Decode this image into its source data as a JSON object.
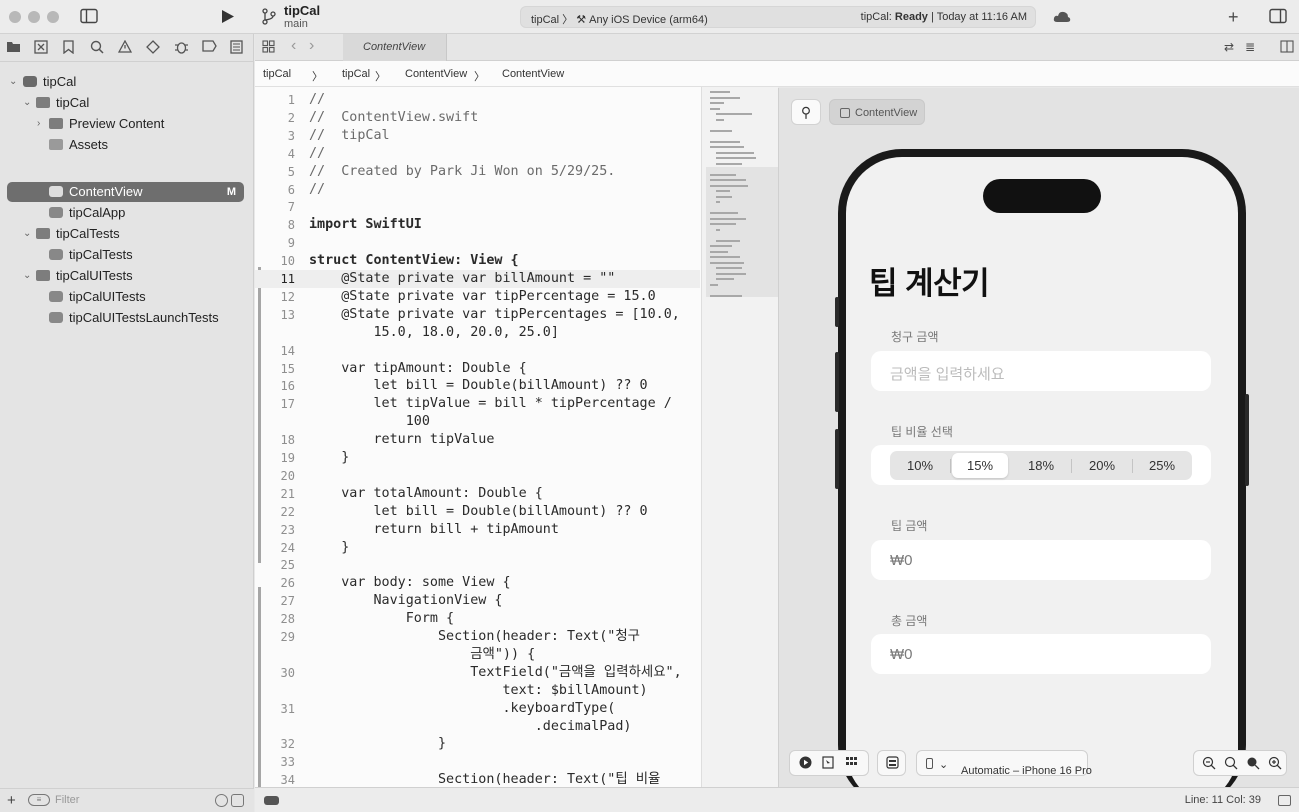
{
  "titlebar": {
    "project": "tipCal",
    "branch": "main",
    "scheme": "tipCal  〉  ⚒ Any iOS Device (arm64)",
    "status_prefix": "tipCal:",
    "status_state": "Ready",
    "status_suffix": "| Today at 11:16 AM"
  },
  "navigator": {
    "rows": [
      {
        "label": "tipCal"
      },
      {
        "label": "tipCal"
      },
      {
        "label": "Preview Content"
      },
      {
        "label": "Assets"
      },
      {
        "label": "ContentView",
        "badge": "M"
      },
      {
        "label": "tipCalApp"
      },
      {
        "label": "tipCalTests"
      },
      {
        "label": "tipCalTests"
      },
      {
        "label": "tipCalUITests"
      },
      {
        "label": "tipCalUITests"
      },
      {
        "label": "tipCalUITestsLaunchTests"
      }
    ],
    "filter_placeholder": "Filter"
  },
  "editor": {
    "tab": "ContentView",
    "jumpbar": [
      "tipCal",
      "〉",
      "tipCal",
      "〉",
      "ContentView",
      "〉",
      "ContentView"
    ],
    "lines": [
      {
        "n": "1",
        "t": "//"
      },
      {
        "n": "2",
        "t": "//  ContentView.swift"
      },
      {
        "n": "3",
        "t": "//  tipCal"
      },
      {
        "n": "4",
        "t": "//"
      },
      {
        "n": "5",
        "t": "//  Created by Park Ji Won on 5/29/25."
      },
      {
        "n": "6",
        "t": "//"
      },
      {
        "n": "7",
        "t": ""
      },
      {
        "n": "8",
        "t": "import SwiftUI"
      },
      {
        "n": "9",
        "t": ""
      },
      {
        "n": "10",
        "t": "struct ContentView: View {"
      },
      {
        "n": "11",
        "t": "    @State private var billAmount = \"\""
      },
      {
        "n": "12",
        "t": "    @State private var tipPercentage = 15.0"
      },
      {
        "n": "13",
        "t": "    @State private var tipPercentages = [10.0,"
      },
      {
        "n": "",
        "t": "        15.0, 18.0, 20.0, 25.0]"
      },
      {
        "n": "14",
        "t": ""
      },
      {
        "n": "15",
        "t": "    var tipAmount: Double {"
      },
      {
        "n": "16",
        "t": "        let bill = Double(billAmount) ?? 0"
      },
      {
        "n": "17",
        "t": "        let tipValue = bill * tipPercentage /"
      },
      {
        "n": "",
        "t": "            100"
      },
      {
        "n": "18",
        "t": "        return tipValue"
      },
      {
        "n": "19",
        "t": "    }"
      },
      {
        "n": "20",
        "t": ""
      },
      {
        "n": "21",
        "t": "    var totalAmount: Double {"
      },
      {
        "n": "22",
        "t": "        let bill = Double(billAmount) ?? 0"
      },
      {
        "n": "23",
        "t": "        return bill + tipAmount"
      },
      {
        "n": "24",
        "t": "    }"
      },
      {
        "n": "25",
        "t": ""
      },
      {
        "n": "26",
        "t": "    var body: some View {"
      },
      {
        "n": "27",
        "t": "        NavigationView {"
      },
      {
        "n": "28",
        "t": "            Form {"
      },
      {
        "n": "29",
        "t": "                Section(header: Text(\"청구"
      },
      {
        "n": "",
        "t": "                    금액\")) {"
      },
      {
        "n": "30",
        "t": "                    TextField(\"금액을 입력하세요\","
      },
      {
        "n": "",
        "t": "                        text: $billAmount)"
      },
      {
        "n": "31",
        "t": "                        .keyboardType("
      },
      {
        "n": "",
        "t": "                            .decimalPad)"
      },
      {
        "n": "32",
        "t": "                }"
      },
      {
        "n": "33",
        "t": ""
      },
      {
        "n": "34",
        "t": "                Section(header: Text(\"팁 비율"
      }
    ],
    "status_position": "Line: 11  Col: 39"
  },
  "canvas": {
    "preview_name": "ContentView",
    "app": {
      "title": "팁 계산기",
      "bill_header": "청구 금액",
      "bill_placeholder": "금액을 입력하세요",
      "tip_rate_header": "팁 비율 선택",
      "tip_options": [
        "10%",
        "15%",
        "18%",
        "20%",
        "25%"
      ],
      "selected_tip": "15%",
      "tip_amount_header": "팁 금액",
      "tip_amount_value": "₩0",
      "total_header": "총 금액",
      "total_value": "₩0"
    },
    "device": "Automatic – iPhone 16 Pro"
  },
  "icons": [
    "sidebar-toggle-icon",
    "run-icon",
    "branch-icon",
    "cloud-icon",
    "plus-icon",
    "inspector-toggle-icon",
    "folder-icon",
    "source-control-icon",
    "bookmark-icon",
    "search-icon",
    "warning-icon",
    "test-icon",
    "debug-icon",
    "breakpoint-icon",
    "report-icon",
    "pin-icon",
    "zoom-out-icon",
    "zoom-fit-icon",
    "zoom-actual-icon",
    "zoom-in-icon"
  ]
}
